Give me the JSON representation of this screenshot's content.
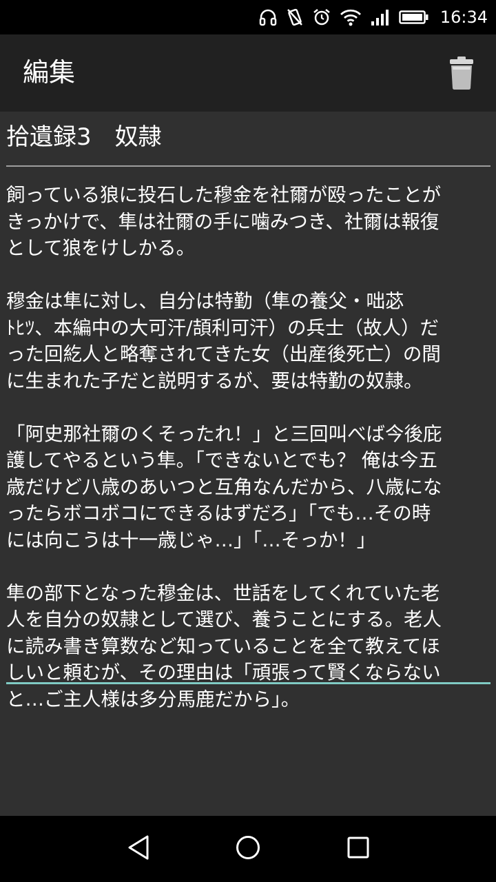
{
  "status_bar": {
    "time": "16:34",
    "icons": [
      "headphones-icon",
      "vibrate-off-icon",
      "alarm-icon",
      "wifi-icon",
      "signal-icon",
      "battery-icon"
    ]
  },
  "app_bar": {
    "title": "編集",
    "delete_icon": "trash-icon"
  },
  "note": {
    "title": "拾遺録3　奴隷",
    "body_lines": [
      [
        "飼っている狼に投石した穆金を社爾が殴ったことが",
        "きっかけで、隼は社爾の手に噛みつき、社爾は報復",
        "として狼をけしかる。"
      ],
      [
        "穆金は隼に対し、自分は特勤（隼の養父・咄苾",
        "ﾄﾋﾂ、本編中の大可汗/頡利可汗）の兵士（故人）だ",
        "った回紇人と略奪されてきた女（出産後死亡）の間",
        "に生まれた子だと説明するが、要は特勤の奴隷。"
      ],
      [
        "「阿史那社爾のくそったれ！」と三回叫べば今後庇",
        "護してやるという隼。「できないとでも？ 俺は今五",
        "歳だけど八歳のあいつと互角なんだから、八歳にな",
        "ったらボコボコにできるはずだろ」「でも…その時",
        "には向こうは十一歳じゃ…」「…そっか！」"
      ],
      [
        "隼の部下となった穆金は、世話をしてくれていた老",
        "人を自分の奴隷として選び、養うことにする。老人",
        "に読み書き算数など知っていることを全て教えてほ",
        "しいと頼むが、その理由は「頑張って賢くならない",
        "と…ご主人様は多分馬鹿だから」。"
      ]
    ]
  },
  "nav_bar": {
    "back_icon": "back-triangle-icon",
    "home_icon": "home-circle-icon",
    "recents_icon": "recents-square-icon"
  },
  "colors": {
    "status_bar": "#000000",
    "app_bar": "#212121",
    "background": "#303030",
    "text": "#ffffff",
    "title_underline": "#9e9e9e",
    "body_underline_accent": "#80cbc4",
    "nav_bar": "#000000"
  }
}
